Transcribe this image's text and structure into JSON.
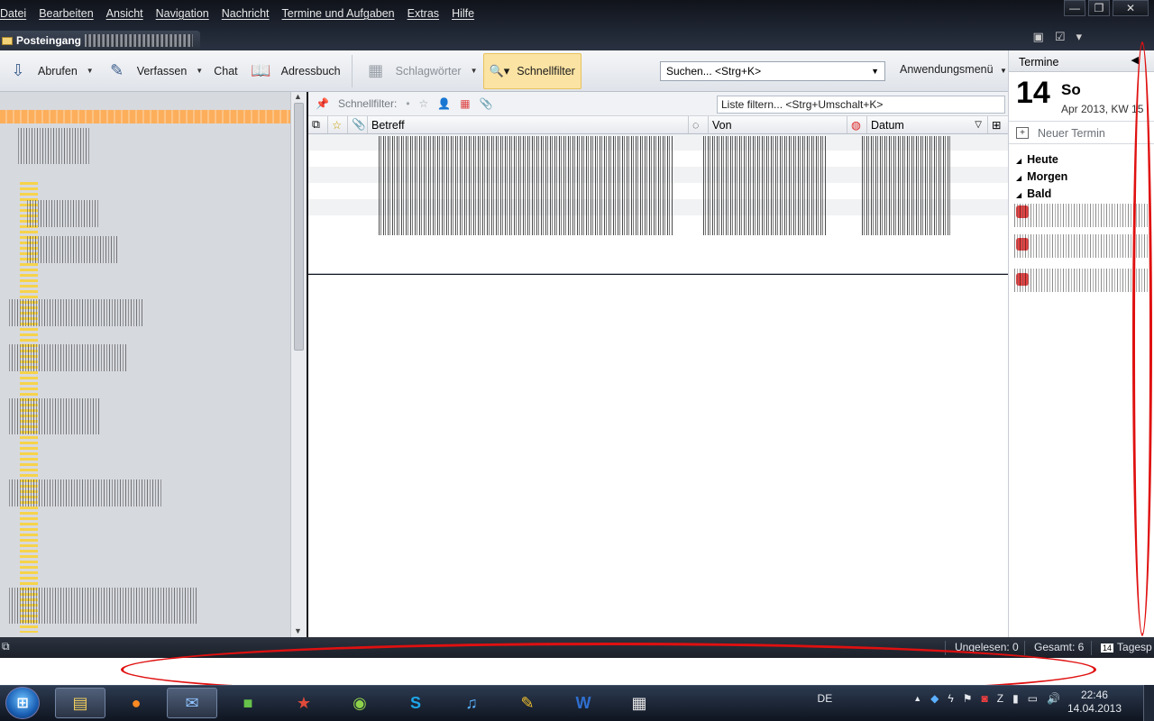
{
  "menu": [
    "Datei",
    "Bearbeiten",
    "Ansicht",
    "Navigation",
    "Nachricht",
    "Termine und Aufgaben",
    "Extras",
    "Hilfe"
  ],
  "window": {
    "min": "—",
    "max": "❐",
    "close": "✕"
  },
  "tab": {
    "title": "Posteingang"
  },
  "toolbar": {
    "get_mail": "Abrufen",
    "compose": "Verfassen",
    "chat": "Chat",
    "address_book": "Adressbuch",
    "tags": "Schlagwörter",
    "quick_filter": "Schnellfilter",
    "search_placeholder": "Suchen... <Strg+K>",
    "app_menu": "Anwendungsmenü"
  },
  "quickfilter": {
    "label": "Schnellfilter:",
    "input_placeholder": "Liste filtern... <Strg+Umschalt+K>"
  },
  "columns": {
    "subject": "Betreff",
    "from": "Von",
    "date": "Datum"
  },
  "today_pane": {
    "title": "Termine",
    "day_number": "14",
    "day_name": "So",
    "month_week": "Apr 2013, KW 15",
    "new_appointment": "Neuer Termin",
    "sections": [
      "Heute",
      "Morgen",
      "Bald"
    ]
  },
  "status": {
    "unread": "Ungelesen: 0",
    "total": "Gesamt: 6",
    "today": "Tagesp"
  },
  "tray": {
    "language": "DE",
    "time": "22:46",
    "date": "14.04.2013"
  },
  "colors": {
    "accent_orange": "#fdae5b",
    "annotation_red": "#e01010",
    "filter_active": "#fbe3a3"
  }
}
